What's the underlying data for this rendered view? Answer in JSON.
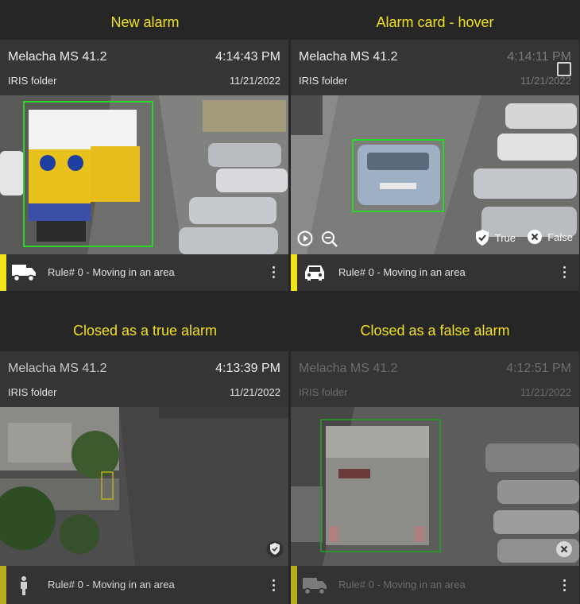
{
  "sections": {
    "new_alarm": "New alarm",
    "hover": "Alarm card - hover",
    "closed_true": "Closed as a true alarm",
    "closed_false": "Closed as a false alarm"
  },
  "cards": [
    {
      "camera": "Melacha MS 41.2",
      "time": "4:14:43 PM",
      "folder": "IRIS folder",
      "date": "11/21/2022",
      "rule": "Rule# 0 - Moving in an area",
      "object_icon": "truck-icon",
      "accent": "#f2e21a"
    },
    {
      "camera": "Melacha MS 41.2",
      "time": "4:14:11 PM",
      "folder": "IRIS folder",
      "date": "11/21/2022",
      "rule": "Rule# 0 - Moving in an area",
      "object_icon": "car-icon",
      "accent": "#f2e21a",
      "true_label": "True",
      "false_label": "False"
    },
    {
      "camera": "Melacha MS 41.2",
      "time": "4:13:39 PM",
      "folder": "IRIS folder",
      "date": "11/21/2022",
      "rule": "Rule# 0 - Moving in an area",
      "object_icon": "person-icon",
      "accent": "#b7ad1e",
      "status_icon": "shield-check-icon"
    },
    {
      "camera": "Melacha MS 41.2",
      "time": "4:12:51 PM",
      "folder": "IRIS folder",
      "date": "11/21/2022",
      "rule": "Rule# 0 - Moving in an area",
      "object_icon": "truck-icon",
      "accent": "#b7ad1e",
      "status_icon": "x-circle-icon"
    }
  ],
  "colors": {
    "title": "#f2e21a",
    "detection_box": "#2bd62b",
    "background": "#262626",
    "card": "#353535"
  }
}
